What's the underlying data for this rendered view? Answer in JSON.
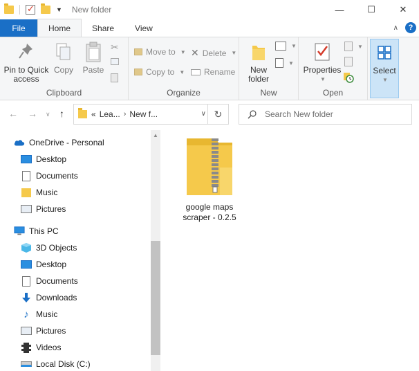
{
  "window": {
    "title": "New folder",
    "minimize": "—",
    "maximize": "☐",
    "close": "✕"
  },
  "tabs": [
    {
      "label": "File"
    },
    {
      "label": "Home"
    },
    {
      "label": "Share"
    },
    {
      "label": "View"
    }
  ],
  "ribbon": {
    "clipboard": {
      "label": "Clipboard",
      "pin_label_1": "Pin to Quick",
      "pin_label_2": "access",
      "copy_label": "Copy",
      "paste_label": "Paste"
    },
    "organize": {
      "label": "Organize",
      "move_to": "Move to",
      "copy_to": "Copy to",
      "delete": "Delete",
      "rename": "Rename"
    },
    "new": {
      "label": "New",
      "new_folder_1": "New",
      "new_folder_2": "folder"
    },
    "open": {
      "label": "Open",
      "properties": "Properties"
    },
    "select": {
      "label": "Select"
    }
  },
  "address": {
    "prefix": "«",
    "segments": [
      "Lea...",
      "New f..."
    ],
    "separator": "›"
  },
  "search": {
    "placeholder": "Search New folder"
  },
  "nav": {
    "items": [
      {
        "label": "OneDrive - Personal",
        "icon": "cloud-icon"
      },
      {
        "label": "Desktop",
        "icon": "desktop-icon"
      },
      {
        "label": "Documents",
        "icon": "documents-icon"
      },
      {
        "label": "Music",
        "icon": "folder-icon"
      },
      {
        "label": "Pictures",
        "icon": "pictures-icon"
      },
      {
        "label": "This PC",
        "icon": "computer-icon"
      },
      {
        "label": "3D Objects",
        "icon": "cube-icon"
      },
      {
        "label": "Desktop",
        "icon": "desktop-icon"
      },
      {
        "label": "Documents",
        "icon": "documents-icon"
      },
      {
        "label": "Downloads",
        "icon": "download-icon"
      },
      {
        "label": "Music",
        "icon": "music-icon"
      },
      {
        "label": "Pictures",
        "icon": "pictures-icon"
      },
      {
        "label": "Videos",
        "icon": "film-icon"
      },
      {
        "label": "Local Disk (C:)",
        "icon": "drive-icon"
      }
    ]
  },
  "files": [
    {
      "label": "google maps scraper - 0.2.5",
      "icon": "zip-folder-icon"
    }
  ],
  "colors": {
    "accent": "#1a6fc6",
    "folder": "#f5c94b"
  }
}
